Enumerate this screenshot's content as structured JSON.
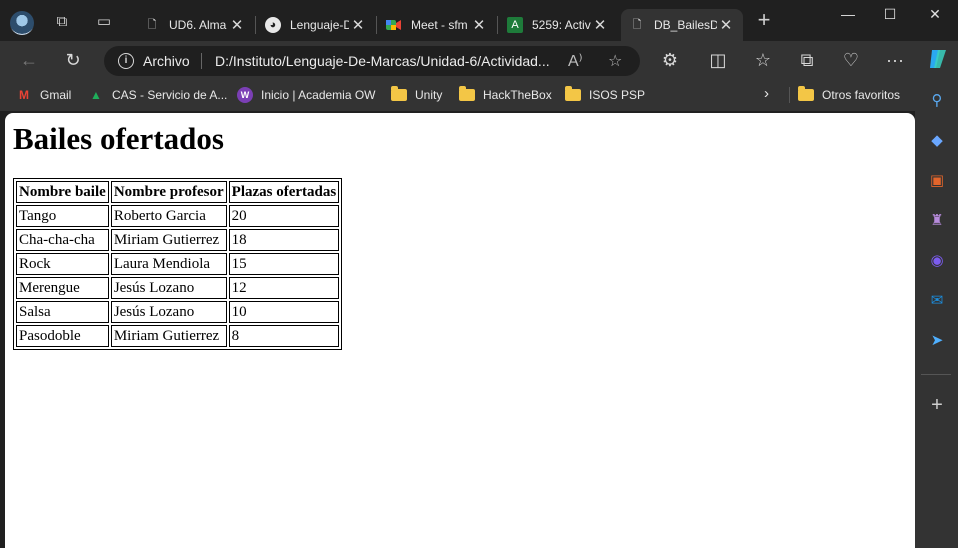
{
  "browser": {
    "tabs": [
      {
        "title": "UD6. Alma",
        "favicon": "document-icon"
      },
      {
        "title": "Lenguaje-D",
        "favicon": "github-icon"
      },
      {
        "title": "Meet - sfm",
        "favicon": "google-meet-icon"
      },
      {
        "title": "5259: Activ",
        "favicon": "aula-icon"
      },
      {
        "title": "DB_BailesD",
        "favicon": "document-icon",
        "active": true
      }
    ],
    "address": {
      "scheme_label": "Archivo",
      "url": "D:/Instituto/Lenguaje-De-Marcas/Unidad-6/Actividad..."
    },
    "bookmarks": [
      {
        "label": "Gmail",
        "icon": "gmail-icon"
      },
      {
        "label": "CAS - Servicio de A...",
        "icon": "cas-icon"
      },
      {
        "label": "Inicio | Academia OW",
        "icon": "academia-ow-icon"
      },
      {
        "label": "Unity",
        "icon": "folder-icon"
      },
      {
        "label": "HackTheBox",
        "icon": "folder-icon"
      },
      {
        "label": "ISOS PSP",
        "icon": "folder-icon"
      }
    ],
    "other_bookmarks_label": "Otros favoritos"
  },
  "page": {
    "heading": "Bailes ofertados",
    "table": {
      "headers": [
        "Nombre baile",
        "Nombre profesor",
        "Plazas ofertadas"
      ],
      "rows": [
        [
          "Tango",
          "Roberto Garcia",
          "20"
        ],
        [
          "Cha-cha-cha",
          "Miriam Gutierrez",
          "18"
        ],
        [
          "Rock",
          "Laura Mendiola",
          "15"
        ],
        [
          "Merengue",
          "Jesús Lozano",
          "12"
        ],
        [
          "Salsa",
          "Jesús Lozano",
          "10"
        ],
        [
          "Pasodoble",
          "Miriam Gutierrez",
          "8"
        ]
      ]
    }
  },
  "colors": {
    "chrome_dark": "#202020",
    "toolbar": "#333333",
    "page_bg": "#ffffff"
  }
}
